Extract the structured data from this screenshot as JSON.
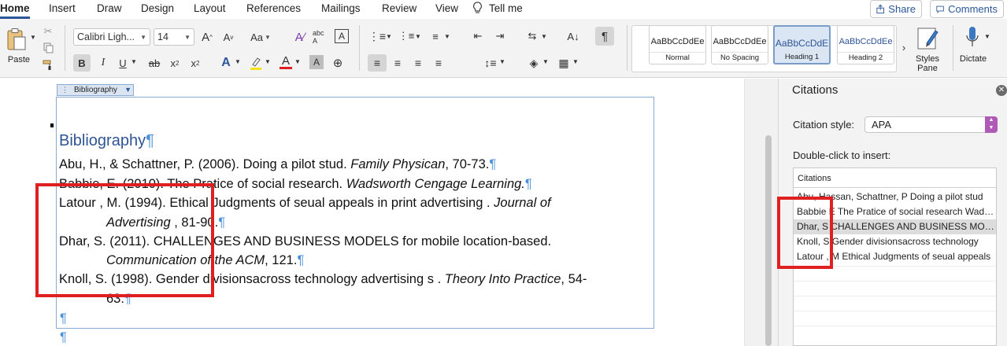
{
  "menu": {
    "items": [
      "Home",
      "Insert",
      "Draw",
      "Design",
      "Layout",
      "References",
      "Mailings",
      "Review",
      "View",
      "Tell me"
    ],
    "share": "Share",
    "comments": "Comments"
  },
  "ribbon": {
    "paste": "Paste",
    "font_name": "Calibri Ligh...",
    "font_size": "14",
    "bold": "B",
    "italic": "I",
    "underline": "U",
    "strike": "ab",
    "subscript": "x",
    "subscript_mark": "2",
    "superscript": "x",
    "superscript_mark": "2",
    "grow_font": "A",
    "shrink_font": "A",
    "change_case": "Aa",
    "styles": [
      {
        "sample": "AaBbCcDdEe",
        "name": "Normal"
      },
      {
        "sample": "AaBbCcDdEe",
        "name": "No Spacing"
      },
      {
        "sample": "AaBbCcDdE",
        "name": "Heading 1"
      },
      {
        "sample": "AaBbCcDdEe",
        "name": "Heading 2"
      }
    ],
    "styles_pane": "Styles\nPane",
    "dictate": "Dictate",
    "accent": "#2b579a"
  },
  "document": {
    "tab_label": "Bibliography",
    "title": "Bibliography",
    "entries": [
      {
        "line1_pre": "Abu, H., & Schattner, P. (2006). Doing a pilot stud. ",
        "line1_it": "Family Physican",
        "line1_post": ", 70-73.",
        "line2_it": "",
        "line2_post": ""
      },
      {
        "line1_pre": "Babbie, E. (2010). The Pratice of social research. ",
        "line1_it": "Wadsworth Cengage Learning.",
        "line1_post": "",
        "line2_it": "",
        "line2_post": ""
      },
      {
        "line1_pre": "Latour , M. (1994). Ethical Judgments of seual appeals in print advertising . ",
        "line1_it": "Journal of",
        "line1_post": "",
        "line2_it": "Advertising ",
        "line2_post": ", 81-90."
      },
      {
        "line1_pre": "Dhar, S. (2011). CHALLENGES AND BUSINESS MODELS for mobile location-based.",
        "line1_it": "",
        "line1_post": "",
        "line2_it": "Communication of the ACM",
        "line2_post": ", 121."
      },
      {
        "line1_pre": "Knoll, S. (1998). Gender divisionsacross technology advertising s . ",
        "line1_it": "Theory Into Practice",
        "line1_post": ", 54-",
        "line2_it": "",
        "line2_post": "63."
      }
    ],
    "pilcrow": "¶"
  },
  "citations_pane": {
    "title": "Citations",
    "style_label": "Citation style:",
    "style_value": "APA",
    "insert_label": "Double-click to insert:",
    "list_header": "Citations",
    "items": [
      "Abu, Hassan,  Schattner, P Doing a pilot stud",
      "Babbie E The Pratice of social research Wadsworth",
      "Dhar, S CHALLENGES AND BUSINESS MODELS",
      "Knoll, S Gender divisionsacross technology",
      "Latour , M Ethical Judgments of seual appeals"
    ],
    "selected_index": 2
  },
  "annotation_color": "#e02020"
}
